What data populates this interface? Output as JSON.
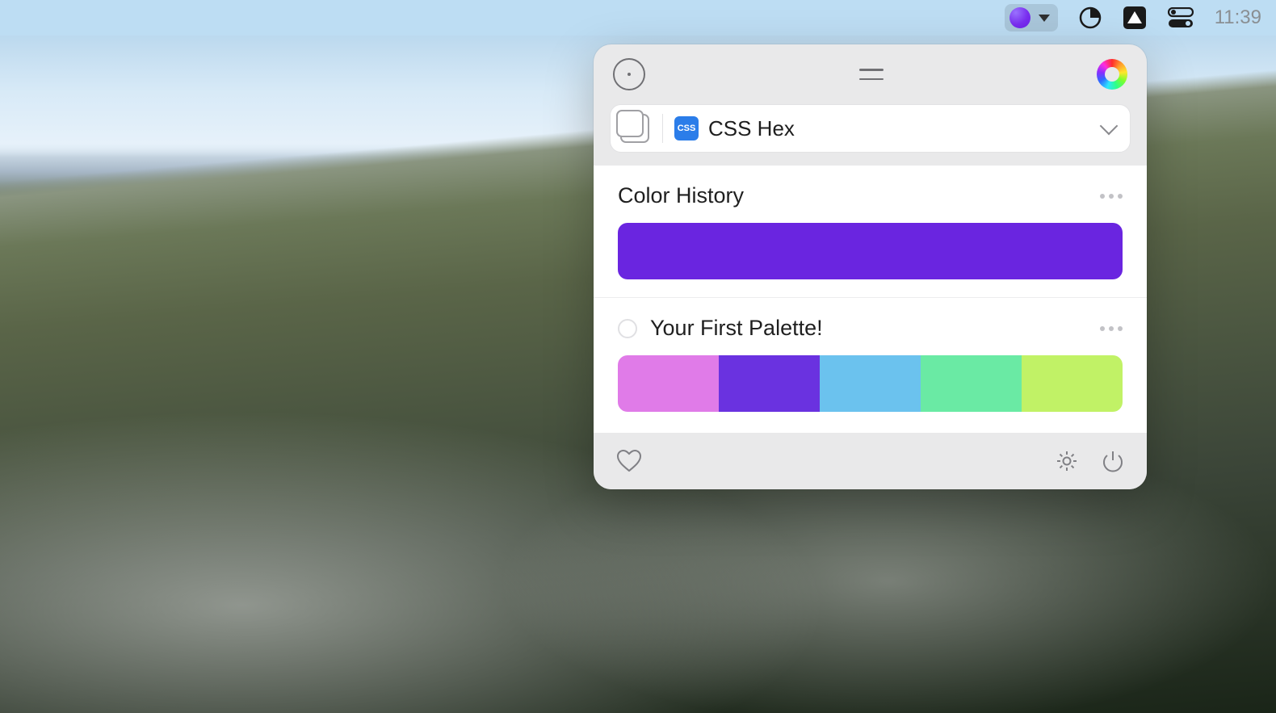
{
  "menubar": {
    "time": "11:39",
    "active_color": "#6a1de8"
  },
  "panel": {
    "format": {
      "badge": "CSS",
      "label": "CSS Hex"
    },
    "history": {
      "title": "Color History",
      "colors": [
        "#6a25e0"
      ]
    },
    "palette": {
      "title": "Your First Palette!",
      "colors": [
        "#e07be8",
        "#6a32e0",
        "#6bc2ee",
        "#6aeaa4",
        "#c1f266"
      ]
    }
  }
}
